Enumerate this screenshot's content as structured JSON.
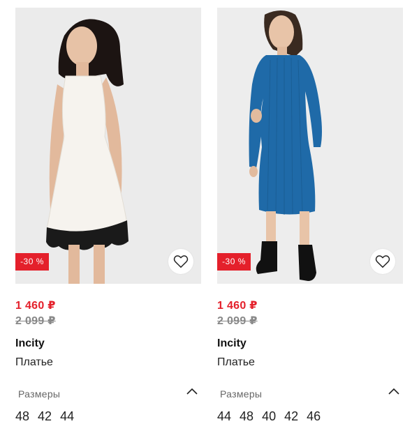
{
  "products": [
    {
      "discount": "-30 %",
      "price_current": "1 460 ₽",
      "price_old": "2 099 ₽",
      "brand": "Incity",
      "type": "Платье",
      "sizes_label": "Размеры",
      "sizes": [
        "48",
        "42",
        "44"
      ],
      "dress_color": "#f6f3ee",
      "lace_color": "#1a1a1a"
    },
    {
      "discount": "-30 %",
      "price_current": "1 460 ₽",
      "price_old": "2 099 ₽",
      "brand": "Incity",
      "type": "Платье",
      "sizes_label": "Размеры",
      "sizes": [
        "44",
        "48",
        "40",
        "42",
        "46"
      ],
      "dress_color": "#1f6aa8",
      "boot_color": "#111111"
    }
  ],
  "colors": {
    "accent_red": "#e4202b",
    "old_price_gray": "#888888",
    "photo_bg": "#ececec"
  },
  "icons": {
    "favorite": "heart-outline-icon",
    "toggle": "chevron-up-icon"
  }
}
